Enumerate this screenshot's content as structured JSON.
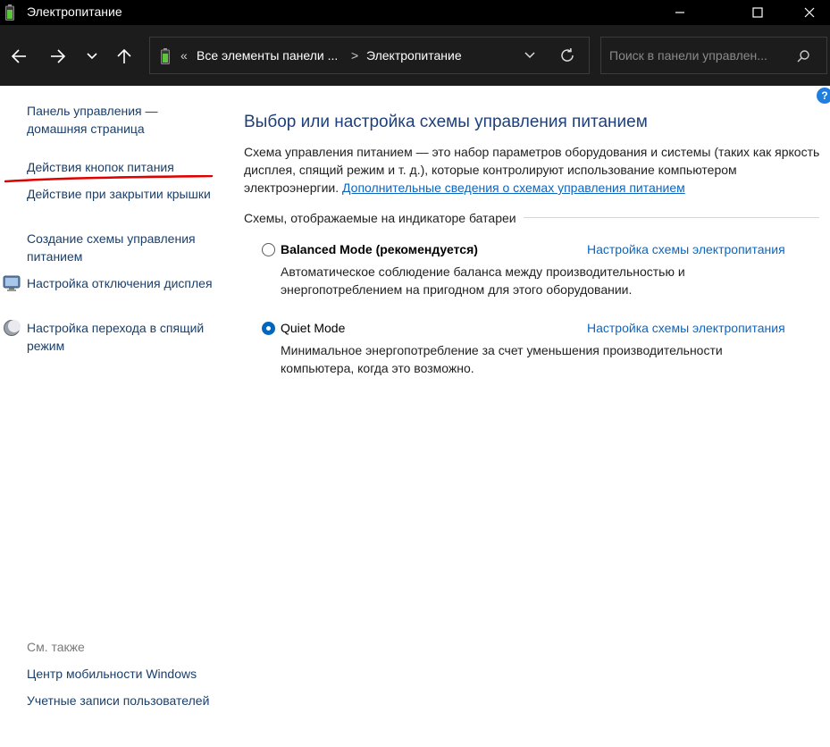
{
  "window": {
    "title": "Электропитание"
  },
  "navbar": {
    "breadcrumb_overflow": "«",
    "breadcrumb_parent": "Все элементы панели ...",
    "breadcrumb_separator": ">",
    "breadcrumb_current": "Электропитание",
    "search_placeholder": "Поиск в панели управлен..."
  },
  "sidebar": {
    "home_link": "Панель управления — домашняя страница",
    "items": [
      {
        "label": "Действия кнопок питания"
      },
      {
        "label": "Действие при закрытии крышки"
      },
      {
        "label": "Создание схемы управления питанием"
      },
      {
        "label": "Настройка отключения дисплея",
        "icon": "display-icon"
      },
      {
        "label": "Настройка перехода в спящий режим",
        "icon": "moon-icon"
      }
    ],
    "see_also_heading": "См. также",
    "see_also": [
      {
        "label": "Центр мобильности Windows"
      },
      {
        "label": "Учетные записи пользователей"
      }
    ]
  },
  "main": {
    "title": "Выбор или настройка схемы управления питанием",
    "description": "Схема управления питанием — это набор параметров оборудования и системы (таких как яркость дисплея, спящий режим и т. д.), которые контролируют использование компьютером электроэнергии.",
    "description_link": "Дополнительные сведения о схемах управления питанием",
    "group_label": "Схемы, отображаемые на индикаторе батареи",
    "plans": [
      {
        "name": "Balanced Mode (рекомендуется)",
        "selected": false,
        "settings_link": "Настройка схемы электропитания",
        "description": "Автоматическое соблюдение баланса между производительностью и энергопотреблением на пригодном для этого оборудовании."
      },
      {
        "name": "Quiet Mode",
        "selected": true,
        "settings_link": "Настройка схемы электропитания",
        "description": "Минимальное энергопотребление за счет уменьшения производительности компьютера, когда это возможно."
      }
    ]
  },
  "help_label": "?",
  "colors": {
    "accent": "#0067c0",
    "link": "#0a66c2",
    "title_blue": "#1e3f78",
    "annotation_red": "#e00000"
  }
}
